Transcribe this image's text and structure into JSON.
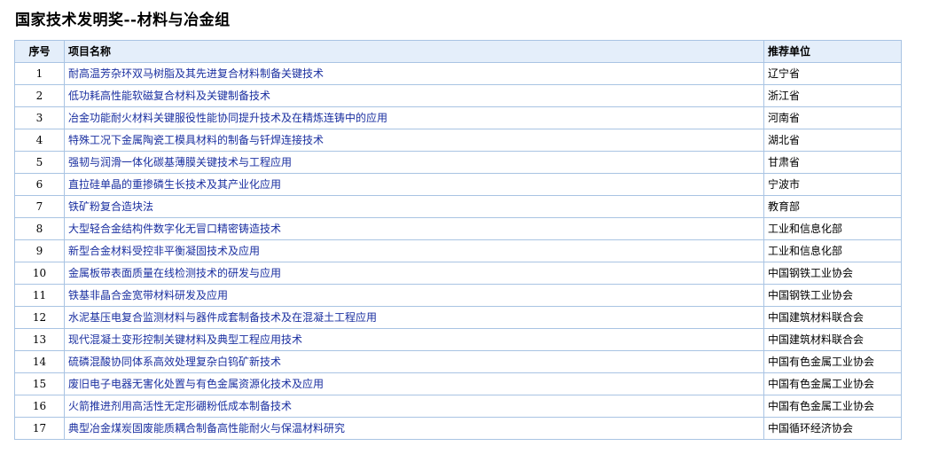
{
  "page": {
    "title": "国家技术发明奖--材料与冶金组"
  },
  "table": {
    "headers": {
      "no": "序号",
      "name": "项目名称",
      "unit": "推荐单位"
    },
    "rows": [
      {
        "no": "1",
        "name": "耐高温芳杂环双马树脂及其先进复合材料制备关键技术",
        "unit": "辽宁省"
      },
      {
        "no": "2",
        "name": "低功耗高性能软磁复合材料及关键制备技术",
        "unit": "浙江省"
      },
      {
        "no": "3",
        "name": "冶金功能耐火材料关键服役性能协同提升技术及在精炼连铸中的应用",
        "unit": "河南省"
      },
      {
        "no": "4",
        "name": "特殊工况下金属陶瓷工模具材料的制备与钎焊连接技术",
        "unit": "湖北省"
      },
      {
        "no": "5",
        "name": "强韧与润滑一体化碳基薄膜关键技术与工程应用",
        "unit": "甘肃省"
      },
      {
        "no": "6",
        "name": "直拉硅单晶的重掺磷生长技术及其产业化应用",
        "unit": "宁波市"
      },
      {
        "no": "7",
        "name": "铁矿粉复合造块法",
        "unit": "教育部"
      },
      {
        "no": "8",
        "name": "大型轻合金结构件数字化无冒口精密铸造技术",
        "unit": "工业和信息化部"
      },
      {
        "no": "9",
        "name": "新型合金材料受控非平衡凝固技术及应用",
        "unit": "工业和信息化部"
      },
      {
        "no": "10",
        "name": "金属板带表面质量在线检测技术的研发与应用",
        "unit": "中国钢铁工业协会"
      },
      {
        "no": "11",
        "name": "铁基非晶合金宽带材料研发及应用",
        "unit": "中国钢铁工业协会"
      },
      {
        "no": "12",
        "name": "水泥基压电复合监测材料与器件成套制备技术及在混凝土工程应用",
        "unit": "中国建筑材料联合会"
      },
      {
        "no": "13",
        "name": "现代混凝土变形控制关键材料及典型工程应用技术",
        "unit": "中国建筑材料联合会"
      },
      {
        "no": "14",
        "name": "硫磷混酸协同体系高效处理复杂白钨矿新技术",
        "unit": "中国有色金属工业协会"
      },
      {
        "no": "15",
        "name": "废旧电子电器无害化处置与有色金属资源化技术及应用",
        "unit": "中国有色金属工业协会"
      },
      {
        "no": "16",
        "name": "火箭推进剂用高活性无定形硼粉低成本制备技术",
        "unit": "中国有色金属工业协会"
      },
      {
        "no": "17",
        "name": "典型冶金煤炭固废能质耦合制备高性能耐火与保温材料研究",
        "unit": "中国循环经济协会"
      }
    ]
  },
  "colors": {
    "header_bg": "#e4eefa",
    "border": "#a9c4e3",
    "link": "#1a2fa0"
  }
}
